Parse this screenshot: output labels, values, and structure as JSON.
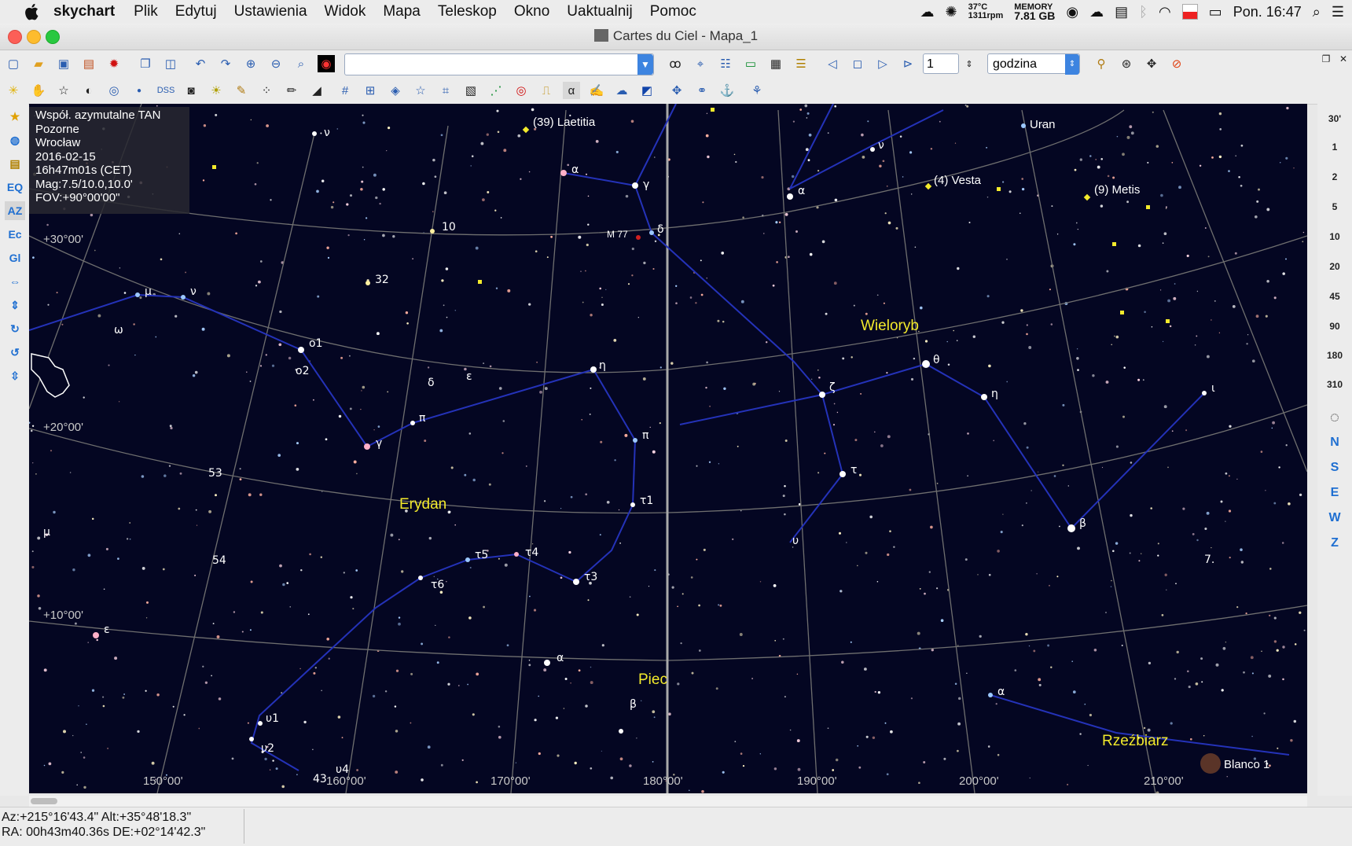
{
  "menubar": {
    "app_name": "skychart",
    "items": [
      "Plik",
      "Edytuj",
      "Ustawienia",
      "Widok",
      "Mapa",
      "Teleskop",
      "Okno",
      "Uaktualnij",
      "Pomoc"
    ],
    "temp": "37°C",
    "fan": "1311rpm",
    "memory_label": "MEMORY",
    "memory_value": "7.81 GB",
    "clock": "Pon. 16:47"
  },
  "window": {
    "title": "Cartes du Ciel - Mapa_1"
  },
  "toolbar": {
    "search_value": "",
    "step_value": "1",
    "time_unit": "godzina"
  },
  "leftbar": {
    "items": [
      "EQ",
      "AZ",
      "Ec",
      "Gl"
    ]
  },
  "rightbar": {
    "fov_items": [
      "30'",
      "1",
      "2",
      "5",
      "10",
      "20",
      "45",
      "90",
      "180",
      "310"
    ],
    "directions": [
      "N",
      "S",
      "E",
      "W",
      "Z"
    ]
  },
  "infobox": {
    "projection": "Współ. azymutalne TAN",
    "mode": "Pozorne",
    "location": "Wrocław",
    "date": "2016-02-15",
    "time": "16h47m01s (CET)",
    "mag": "Mag:7.5/10.0,10.0'",
    "fov": "FOV:+90°00'00\""
  },
  "chart": {
    "dec_labels": [
      "+30°00'",
      "+20°00'",
      "+10°00'"
    ],
    "ra_labels": [
      "150°00'",
      "160°00'",
      "170°00'",
      "180°00'",
      "190°00'",
      "200°00'",
      "210°00'"
    ],
    "constellations": [
      "Wieloryb",
      "Erydan",
      "Piec",
      "Rzeźbiarz"
    ],
    "solar_system": [
      "(39) Laetitia",
      "Uran",
      "(4) Vesta",
      "(9) Metis"
    ],
    "deep_sky": [
      "M 77",
      "Blanco 1"
    ],
    "star_labels": [
      "ν",
      "α",
      "γ",
      "δ",
      "ν",
      "α",
      "10",
      "32",
      "μ",
      "ν",
      "ω",
      "o1",
      "o2",
      "δ",
      "ε",
      "η",
      "θ",
      "ζ",
      "η",
      "ι",
      "π",
      "γ",
      "π",
      "τ",
      "53",
      "τ1",
      "μ",
      "τ5",
      "τ4",
      "τ3",
      "τ6",
      "υ",
      "β",
      "7.",
      "54",
      "ε",
      "α",
      "β",
      "α",
      "υ1",
      "υ2",
      "43",
      "υ4",
      "τ4"
    ]
  },
  "status": {
    "altaz": "Az:+215°16'43.4\" Alt:+35°48'18.3\"",
    "radec": "RA: 00h43m40.36s DE:+02°14'42.3\""
  },
  "colors": {
    "sky": "#040622",
    "constellation_line": "#2432b8",
    "constellation_name": "#f3ea2c",
    "grid": "#6f6f6f"
  }
}
